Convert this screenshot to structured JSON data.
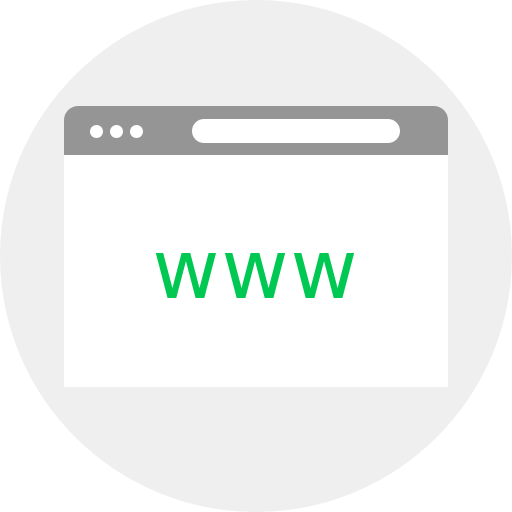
{
  "content": {
    "text": "www"
  },
  "colors": {
    "background_circle": "#efefef",
    "titlebar": "#959595",
    "window": "#ffffff",
    "text": "#00c853"
  },
  "icons": [
    "window-control-dot",
    "window-control-dot",
    "window-control-dot",
    "address-bar"
  ]
}
